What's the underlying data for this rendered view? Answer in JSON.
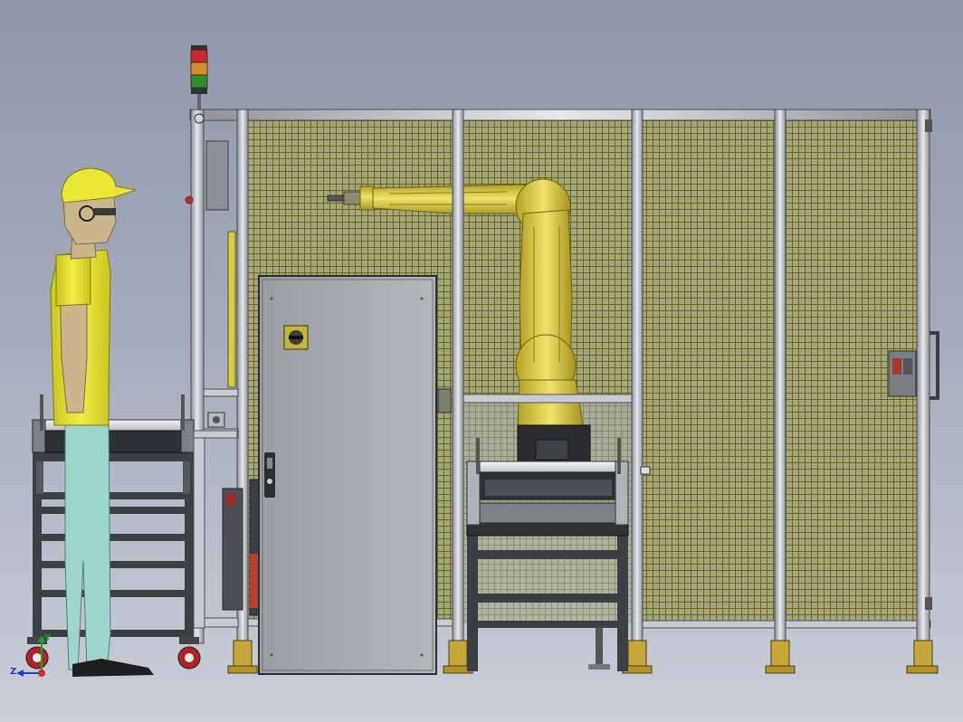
{
  "viewport": {
    "background_top": "#8f98aa",
    "background_bottom": "#c9cfd9"
  },
  "colors": {
    "frame_metal": "#c8ccd2",
    "frame_edge": "#4a4e55",
    "mesh_fill": "#9ea27a",
    "mesh_wire": "#6c6a17",
    "robot_yellow": "#e8d84a",
    "robot_shadow": "#9c8e1c",
    "door_grey": "#a3a6ab",
    "cart_dark": "#3c3f44",
    "worker_shirt": "#e9e634",
    "worker_pants": "#9fd6cb",
    "worker_skin": "#cbb58a",
    "light_red": "#c8292c",
    "light_amber": "#d48e2a",
    "light_green": "#2e8f2a",
    "foot_plate": "#c7a63a"
  },
  "icons": {
    "stack_light": "tower-signal-light-icon",
    "door_handle": "door-handle-icon",
    "lockout": "rotary-disconnect-switch-icon",
    "axis": "coordinate-triad-icon"
  },
  "axis_triad": {
    "x_label": "",
    "y_label": "Y",
    "z_label": "Z"
  }
}
